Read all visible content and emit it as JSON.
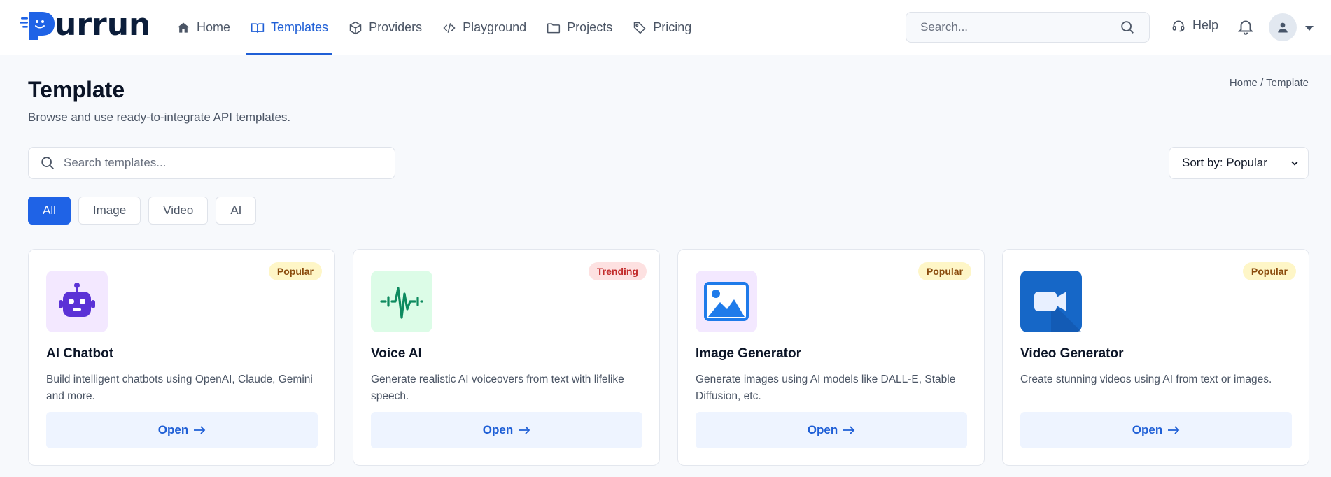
{
  "brand": {
    "name": "urrun",
    "accent": "#1f63e6"
  },
  "nav": {
    "items": [
      {
        "label": "Home",
        "icon": "home-icon"
      },
      {
        "label": "Templates",
        "icon": "book-open-icon",
        "active": true
      },
      {
        "label": "Providers",
        "icon": "cube-icon"
      },
      {
        "label": "Playground",
        "icon": "code-icon"
      },
      {
        "label": "Projects",
        "icon": "folder-icon"
      },
      {
        "label": "Pricing",
        "icon": "tag-icon"
      }
    ]
  },
  "topbar": {
    "search_placeholder": "Search...",
    "help_label": "Help"
  },
  "page": {
    "title": "Template",
    "subtitle": "Browse and use ready-to-integrate API templates.",
    "breadcrumb": "Home / Template",
    "search_placeholder": "Search templates...",
    "sort_label": "Sort by: Popular"
  },
  "filters": [
    {
      "label": "All",
      "active": true
    },
    {
      "label": "Image"
    },
    {
      "label": "Video"
    },
    {
      "label": "AI"
    }
  ],
  "cards": [
    {
      "title": "AI Chatbot",
      "description": "Build intelligent chatbots using OpenAI, Claude, Gemini and more.",
      "badge": "Popular",
      "badge_type": "popular",
      "icon": "robot-icon",
      "button": "Open"
    },
    {
      "title": "Voice AI",
      "description": "Generate realistic AI voiceovers from text with lifelike speech.",
      "badge": "Trending",
      "badge_type": "trending",
      "icon": "waveform-icon",
      "button": "Open"
    },
    {
      "title": "Image Generator",
      "description": "Generate images using AI models like DALL-E, Stable Diffusion, etc.",
      "badge": "Popular",
      "badge_type": "popular",
      "icon": "image-icon",
      "button": "Open"
    },
    {
      "title": "Video Generator",
      "description": "Create stunning videos using AI from text or images.",
      "badge": "Popular",
      "badge_type": "popular",
      "icon": "video-camera-icon",
      "button": "Open"
    }
  ]
}
